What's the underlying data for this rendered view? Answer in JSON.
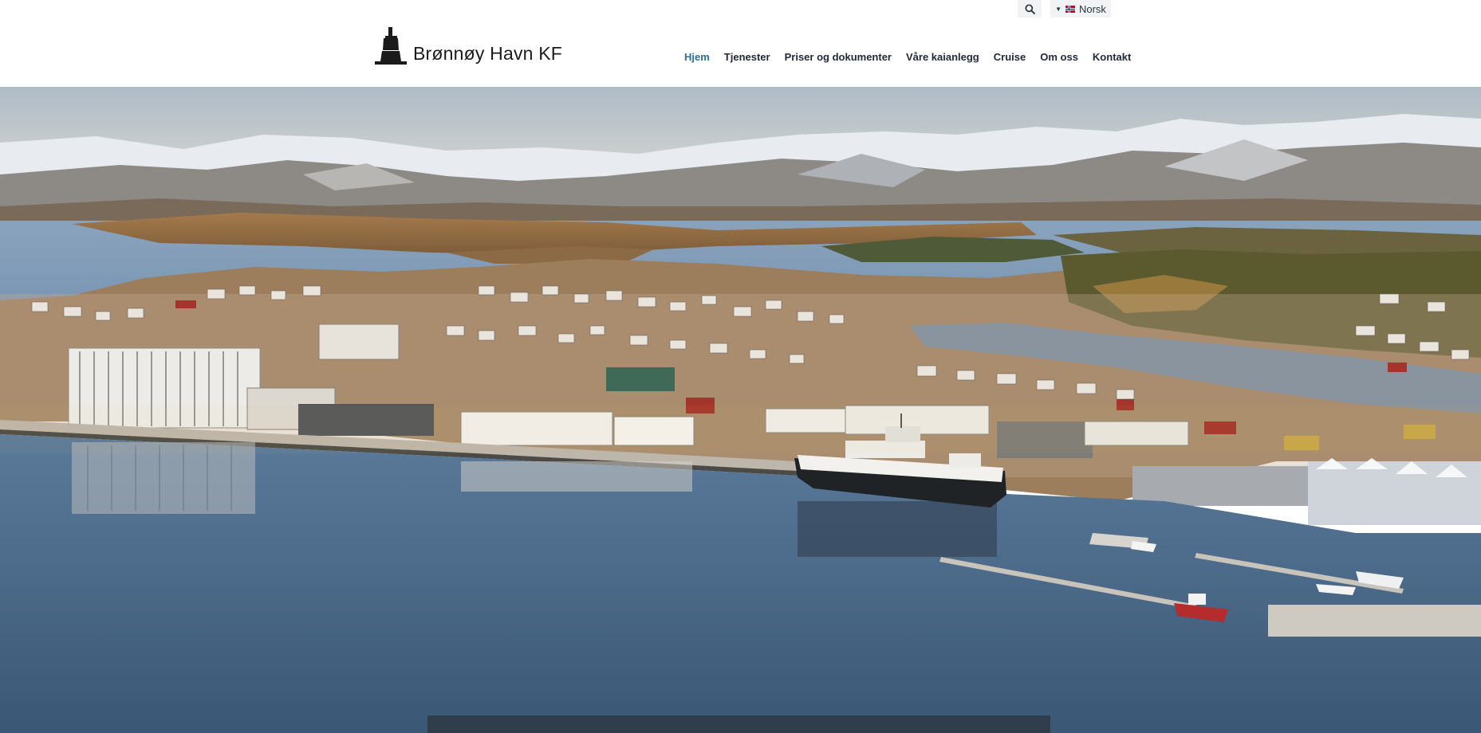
{
  "header": {
    "logo_text": "Brønnøy Havn KF",
    "logo_icon": "lighthouse-logo-icon"
  },
  "utility": {
    "search_icon": "search-icon",
    "language": {
      "label": "Norsk",
      "flag": "norway-flag-icon",
      "chevron": "chevron-down-icon"
    }
  },
  "nav": {
    "items": [
      {
        "label": "Hjem",
        "active": true
      },
      {
        "label": "Tjenester",
        "active": false
      },
      {
        "label": "Priser og dokumenter",
        "active": false
      },
      {
        "label": "Våre kaianlegg",
        "active": false
      },
      {
        "label": "Cruise",
        "active": false
      },
      {
        "label": "Om oss",
        "active": false
      },
      {
        "label": "Kontakt",
        "active": false
      }
    ]
  },
  "hero": {
    "image": "aerial-harbor-town-photo"
  },
  "colors": {
    "nav_active": "#2a6f9e",
    "nav_text": "#1f2937",
    "overlay_bar": "#2f3c47"
  }
}
